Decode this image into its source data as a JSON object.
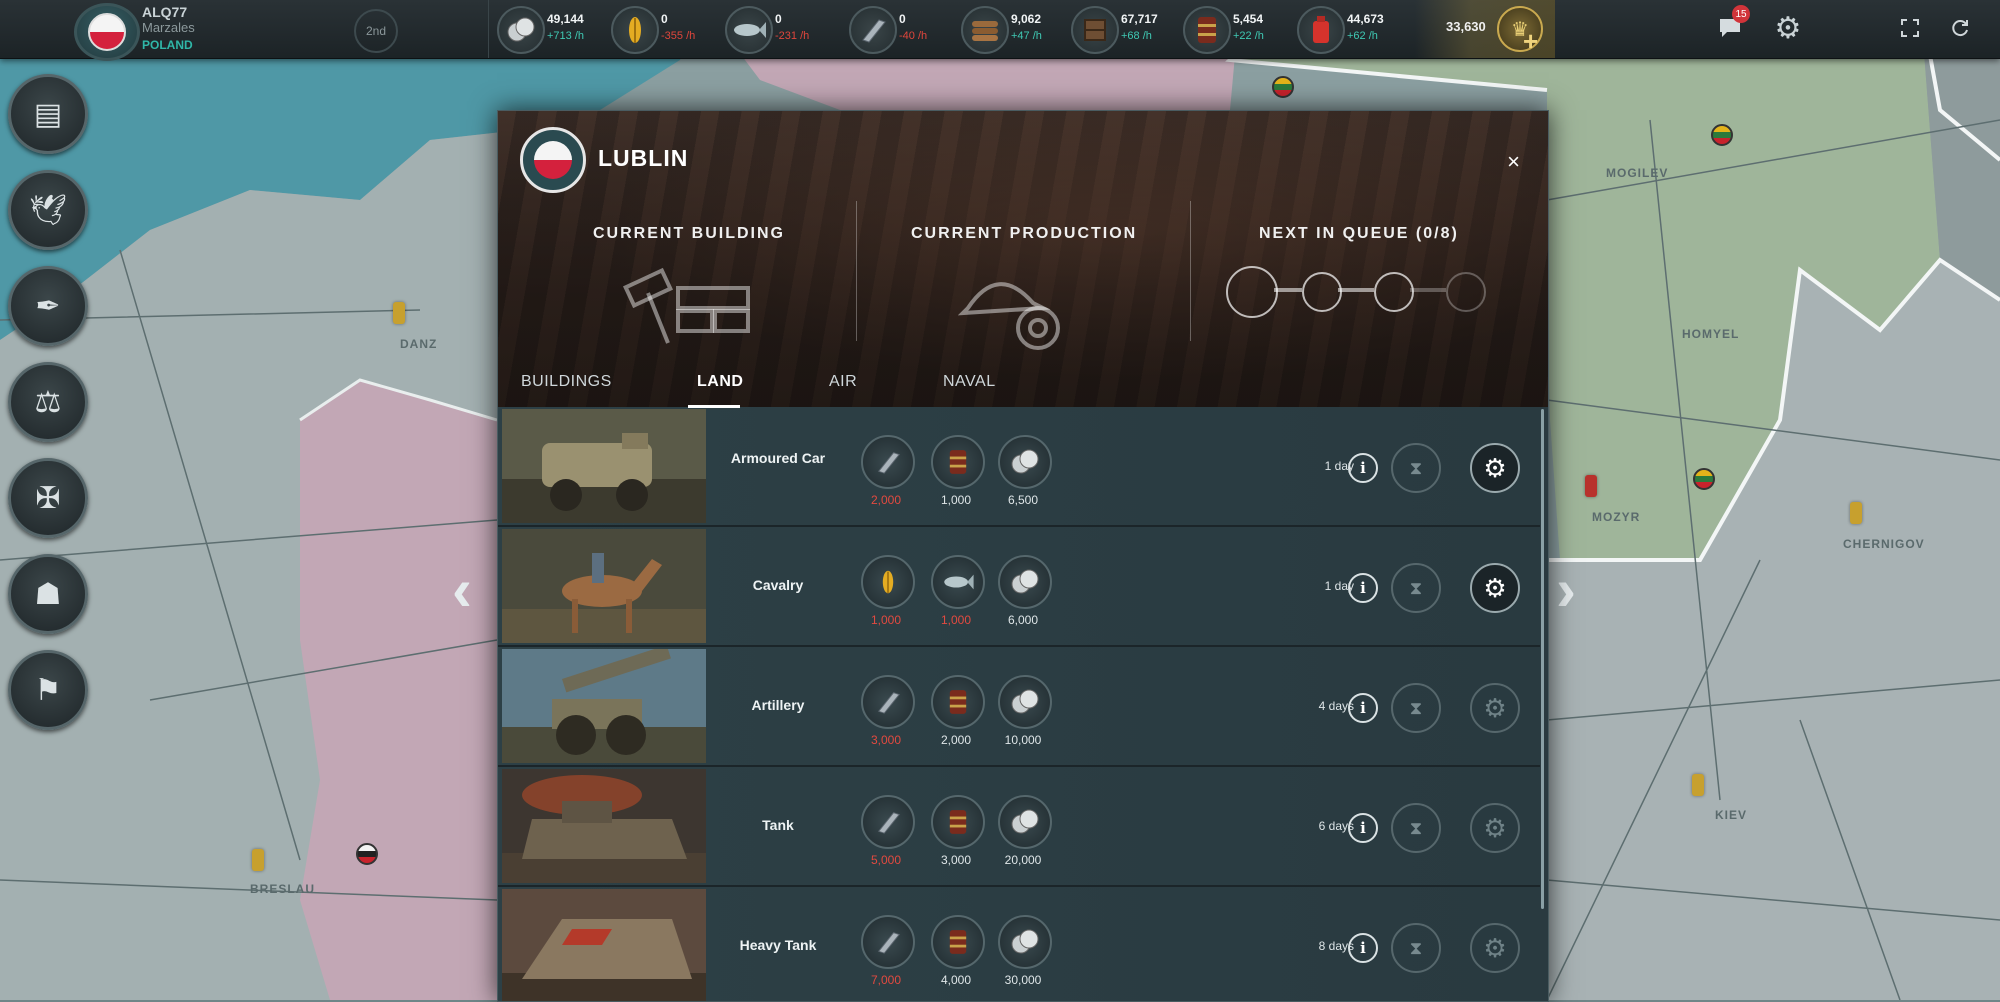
{
  "player": {
    "name": "ALQ77",
    "subtitle": "Marzales",
    "country": "POLAND",
    "rank": "2nd"
  },
  "resources": [
    {
      "name": "money",
      "icon": "coins-icon",
      "value": "49,144",
      "rate": "+713 /h",
      "rate_sign": "pos"
    },
    {
      "name": "food",
      "icon": "grain-icon",
      "value": "0",
      "rate": "-355 /h",
      "rate_sign": "neg"
    },
    {
      "name": "fish",
      "icon": "fish-icon",
      "value": "0",
      "rate": "-231 /h",
      "rate_sign": "neg"
    },
    {
      "name": "steel",
      "icon": "steel-beam-icon",
      "value": "0",
      "rate": "-40 /h",
      "rate_sign": "neg"
    },
    {
      "name": "wood",
      "icon": "wood-logs-icon",
      "value": "9,062",
      "rate": "+47 /h",
      "rate_sign": "pos"
    },
    {
      "name": "goods",
      "icon": "crate-icon",
      "value": "67,717",
      "rate": "+68 /h",
      "rate_sign": "pos"
    },
    {
      "name": "oil",
      "icon": "oil-barrel-icon",
      "value": "5,454",
      "rate": "+22 /h",
      "rate_sign": "pos"
    },
    {
      "name": "fuel",
      "icon": "gas-can-icon",
      "value": "44,673",
      "rate": "+62 /h",
      "rate_sign": "pos"
    }
  ],
  "gold": {
    "value": "33,630"
  },
  "messages": {
    "badge": "15"
  },
  "map_labels": [
    "DANZ",
    "BRESLAU",
    "MOGILEV",
    "HOMYEL",
    "MOZYR",
    "CHERNIGOV",
    "KIEV"
  ],
  "dialog": {
    "city": "LUBLIN",
    "close_label": "×",
    "sections": {
      "current_building": "CURRENT BUILDING",
      "current_production": "CURRENT PRODUCTION",
      "next_in_queue": "NEXT IN QUEUE (0/8)"
    },
    "tabs": [
      {
        "label": "BUILDINGS",
        "active": false
      },
      {
        "label": "LAND",
        "active": true
      },
      {
        "label": "AIR",
        "active": false
      },
      {
        "label": "NAVAL",
        "active": false
      }
    ],
    "units": [
      {
        "name": "Armoured Car",
        "duration": "1 day",
        "producible": true,
        "costs": [
          {
            "icon": "steel-beam-icon",
            "value": "2,000",
            "lacking": true
          },
          {
            "icon": "oil-barrel-icon",
            "value": "1,000",
            "lacking": false
          },
          {
            "icon": "coins-icon",
            "value": "6,500",
            "lacking": false
          }
        ]
      },
      {
        "name": "Cavalry",
        "duration": "1 day",
        "producible": true,
        "costs": [
          {
            "icon": "grain-icon",
            "value": "1,000",
            "lacking": true
          },
          {
            "icon": "fish-icon",
            "value": "1,000",
            "lacking": true
          },
          {
            "icon": "coins-icon",
            "value": "6,000",
            "lacking": false
          }
        ]
      },
      {
        "name": "Artillery",
        "duration": "4 days",
        "producible": false,
        "costs": [
          {
            "icon": "steel-beam-icon",
            "value": "3,000",
            "lacking": true
          },
          {
            "icon": "oil-barrel-icon",
            "value": "2,000",
            "lacking": false
          },
          {
            "icon": "coins-icon",
            "value": "10,000",
            "lacking": false
          }
        ]
      },
      {
        "name": "Tank",
        "duration": "6 days",
        "producible": false,
        "costs": [
          {
            "icon": "steel-beam-icon",
            "value": "5,000",
            "lacking": true
          },
          {
            "icon": "oil-barrel-icon",
            "value": "3,000",
            "lacking": false
          },
          {
            "icon": "coins-icon",
            "value": "20,000",
            "lacking": false
          }
        ]
      },
      {
        "name": "Heavy Tank",
        "duration": "8 days",
        "producible": false,
        "costs": [
          {
            "icon": "steel-beam-icon",
            "value": "7,000",
            "lacking": true
          },
          {
            "icon": "oil-barrel-icon",
            "value": "4,000",
            "lacking": false
          },
          {
            "icon": "coins-icon",
            "value": "30,000",
            "lacking": false
          }
        ]
      }
    ]
  },
  "colors": {
    "positive": "#3fc9b4",
    "negative": "#e0463c",
    "accent_gold": "#e9cf75"
  }
}
